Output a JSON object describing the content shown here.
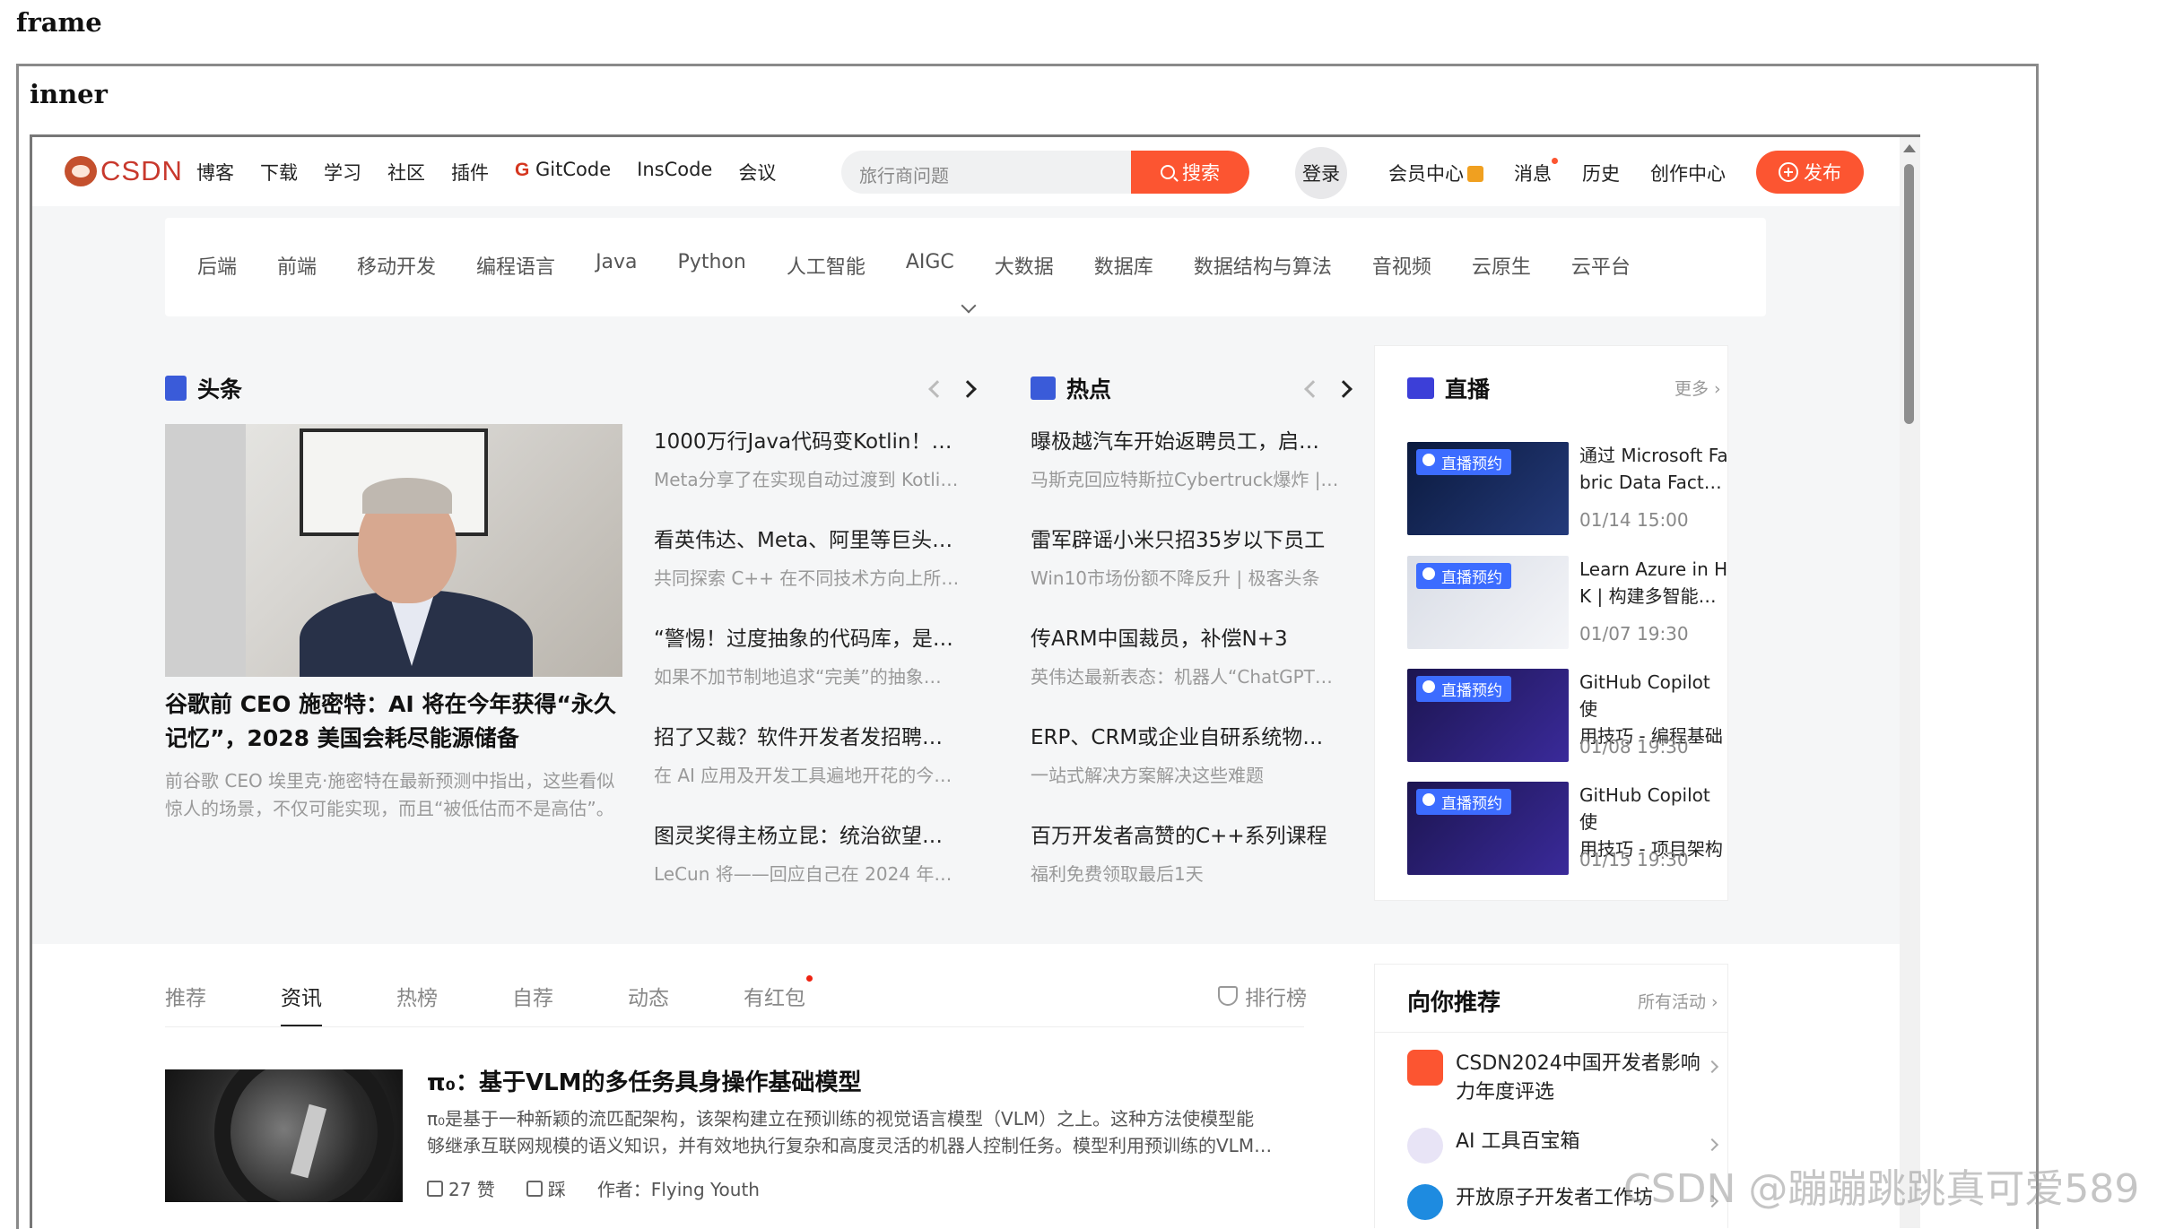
{
  "labels": {
    "frame": "frame",
    "inner": "inner"
  },
  "logo": {
    "text": "CSDN"
  },
  "topnav": {
    "links": [
      "博客",
      "下载",
      "学习",
      "社区",
      "插件",
      "GitCode",
      "InsCode",
      "会议"
    ],
    "search_placeholder": "旅行商问题",
    "search_button": "搜索",
    "login": "登录",
    "right_links": [
      "会员中心",
      "消息",
      "历史",
      "创作中心"
    ],
    "publish": "发布"
  },
  "categories": [
    "后端",
    "前端",
    "移动开发",
    "编程语言",
    "Java",
    "Python",
    "人工智能",
    "AIGC",
    "大数据",
    "数据库",
    "数据结构与算法",
    "音视频",
    "云原生",
    "云平台"
  ],
  "headlines": {
    "title": "头条",
    "main_title": "谷歌前 CEO 施密特：AI 将在今年获得“永久记忆”，2028 美国会耗尽能源储备",
    "main_desc": "前谷歌 CEO 埃里克·施密特在最新预测中指出，这些看似惊人的场景，不仅可能实现，而且“被低估而不是高估”。",
    "items": [
      {
        "title": "1000万行Java代码变Kotlin！…",
        "desc": "Meta分享了在实现自动过渡到 Kotli…"
      },
      {
        "title": "看英伟达、Meta、阿里等巨头…",
        "desc": "共同探索 C++ 在不同技术方向上所…"
      },
      {
        "title": "“警惕！过度抽象的代码库，是…",
        "desc": "如果不加节制地追求“完美”的抽象…"
      },
      {
        "title": "招了又裁？软件开发者发招聘…",
        "desc": "在 AI 应用及开发工具遍地开花的今…"
      },
      {
        "title": "图灵奖得主杨立昆：统治欲望…",
        "desc": "LeCun 将——回应自己在 2024 年…"
      }
    ]
  },
  "hot": {
    "title": "热点",
    "items": [
      {
        "title": "曝极越汽车开始返聘员工，启…",
        "desc": "马斯克回应特斯拉Cybertruck爆炸 |…"
      },
      {
        "title": "雷军辟谣小米只招35岁以下员工",
        "desc": "Win10市场份额不降反升 | 极客头条"
      },
      {
        "title": "传ARM中国裁员，补偿N+3",
        "desc": "英伟达最新表态：机器人“ChatGPT…"
      },
      {
        "title": "ERP、CRM或企业自研系统物…",
        "desc": "一站式解决方案解决这些难题"
      },
      {
        "title": "百万开发者高赞的C++系列课程",
        "desc": "福利免费领取最后1天"
      }
    ]
  },
  "live": {
    "title": "直播",
    "more": "更多",
    "badge": "直播预约",
    "items": [
      {
        "line1": "通过 Microsoft Fa",
        "line2": "bric Data Facto…",
        "time": "01/14 15:00"
      },
      {
        "line1": "Learn Azure in H",
        "line2": "K | 构建多智能…",
        "time": "01/07 19:30"
      },
      {
        "line1": "GitHub Copilot 使",
        "line2": "用技巧 - 编程基础",
        "time": "01/08 19:30"
      },
      {
        "line1": "GitHub Copilot 使",
        "line2": "用技巧 - 项目架构",
        "time": "01/15 19:30"
      }
    ]
  },
  "feed": {
    "tabs": [
      "推荐",
      "资讯",
      "热榜",
      "自荐",
      "动态",
      "有红包"
    ],
    "rank": "排行榜",
    "article": {
      "title": "π₀：基于VLM的多任务具身操作基础模型",
      "desc1": "π₀是基于一种新颖的流匹配架构，该架构建立在预训练的视觉语言模型（VLM）之上。这种方法使模型能",
      "desc2": "够继承互联网规模的语义知识，并有效地执行复杂和高度灵活的机器人控制任务。模型利用预训练的VLM…",
      "likes": "27 赞",
      "dislike": "踩",
      "author": "作者：Flying Youth"
    }
  },
  "recommend": {
    "title": "向你推荐",
    "more": "所有活动",
    "items": [
      "CSDN2024中国开发者影响力年度评选",
      "AI 工具百宝箱",
      "开放原子开发者工作坊"
    ]
  },
  "watermark": "CSDN @蹦蹦跳跳真可爱589",
  "colors": {
    "accent": "#fc5531",
    "brand": "#c8382c",
    "live_blue": "#3c6cff"
  }
}
